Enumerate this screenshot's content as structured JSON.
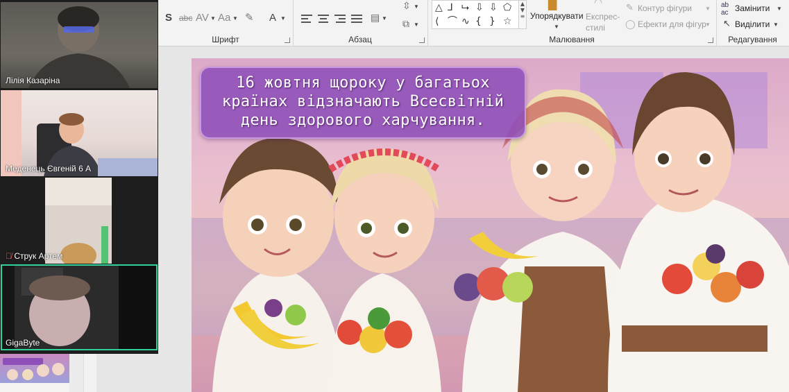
{
  "participants": [
    {
      "name": "Лілія Казаріна",
      "muted": false,
      "active": false
    },
    {
      "name": "Меденець Євгеній 6 А",
      "muted": false,
      "active": false
    },
    {
      "name": "Струк Артем",
      "muted": true,
      "active": false
    },
    {
      "name": "GigaByte",
      "muted": false,
      "active": true
    }
  ],
  "ribbon": {
    "groups": {
      "font": "Шрифт",
      "paragraph": "Абзац",
      "drawing": "Малювання",
      "editing": "Редагування"
    },
    "font_buttons": [
      "S",
      "abc",
      "AV",
      "Aa",
      "A"
    ],
    "drawing": {
      "arrange": "Упорядкувати",
      "quick_styles": "Експрес-стилі",
      "shape_outline": "Контур фігури",
      "shape_effects": "Ефекти для фігур"
    },
    "editing": {
      "replace": "Замінити",
      "select": "Виділити"
    }
  },
  "slide": {
    "caption": "16 жовтня щороку у багатьох країнах відзначають Всесвітній день здорового харчування."
  },
  "colors": {
    "active_outline": "#2fd39a",
    "caption_bg": "#8e4fb8",
    "ribbon_bg": "#f3f3f3"
  }
}
